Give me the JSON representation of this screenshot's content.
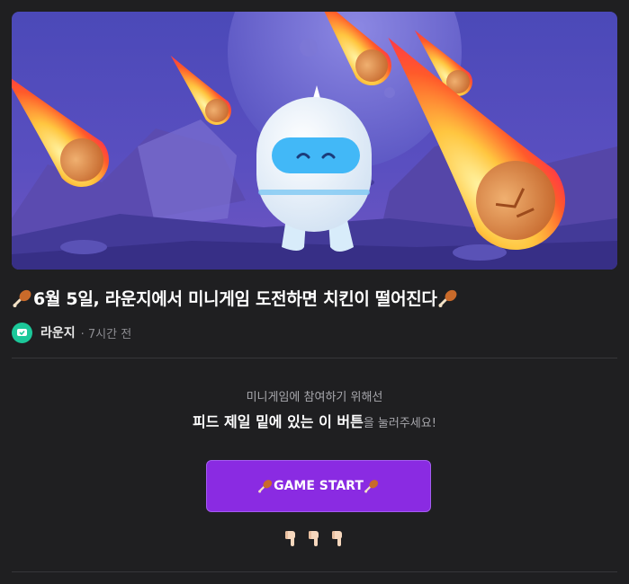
{
  "post": {
    "title": "6월 5일, 라운지에서 미니게임 도전하면 치킨이 떨어진다",
    "author": "라운지",
    "time": "· 7시간 전"
  },
  "info": {
    "line1": "미니게임에 참여하기 위해선",
    "line2_bold": "피드 제일 밑에 있는 이 버튼",
    "line2_rest": "을 눌러주세요!"
  },
  "cta": {
    "label": "GAME START"
  },
  "icons": {
    "title_left": "chicken-drumstick-icon",
    "title_right": "chicken-drumstick-icon",
    "pointing": "pointing-down-hand-icon"
  },
  "colors": {
    "accent": "#8a2be2",
    "avatar": "#1cc89a",
    "background": "#1f1f21"
  }
}
